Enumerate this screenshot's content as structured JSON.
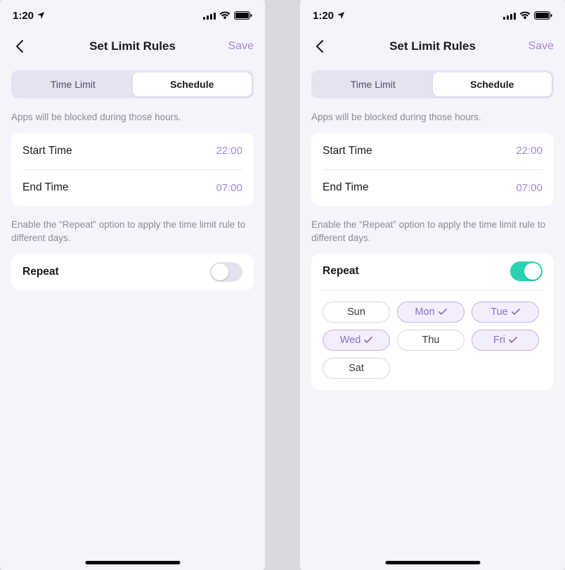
{
  "status": {
    "time": "1:20"
  },
  "nav": {
    "title": "Set Limit Rules",
    "save": "Save"
  },
  "tabs": {
    "time_limit": "Time Limit",
    "schedule": "Schedule"
  },
  "hint_top": "Apps will be blocked during those hours.",
  "times": {
    "start_label": "Start Time",
    "start_value": "22:00",
    "end_label": "End Time",
    "end_value": "07:00"
  },
  "hint_repeat": "Enable the “Repeat” option to apply the time limit rule to different days.",
  "repeat": {
    "label": "Repeat"
  },
  "days": {
    "sun": "Sun",
    "mon": "Mon",
    "tue": "Tue",
    "wed": "Wed",
    "thu": "Thu",
    "fri": "Fri",
    "sat": "Sat"
  }
}
